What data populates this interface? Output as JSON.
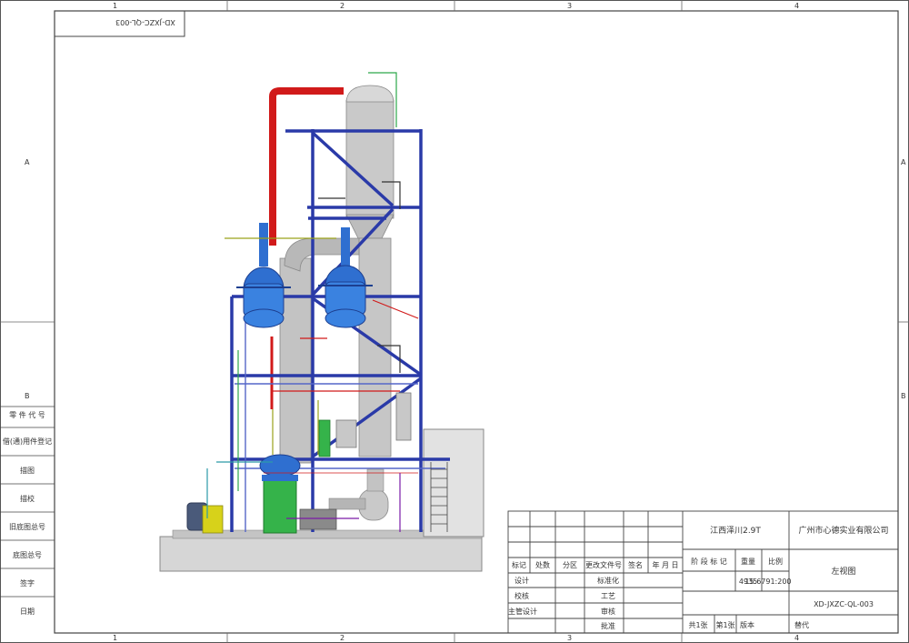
{
  "border": {
    "cols_top": [
      "1",
      "2",
      "3",
      "4"
    ],
    "cols_bottom": [
      "1",
      "2",
      "3",
      "4"
    ],
    "rows_left": [
      "A",
      "B"
    ],
    "rows_right": [
      "A",
      "B"
    ]
  },
  "mirrored_code": "XD-JXZC-QL-003",
  "left_strip": [
    "零 件 代 号",
    "借(通)用件登记",
    "描图",
    "描校",
    "旧底图总号",
    "底图总号",
    "签字",
    "日期"
  ],
  "title_block": {
    "material": "江西泽川2.9T",
    "company": "广州市心德实业有限公司",
    "view_name": "左视图",
    "drawing_no": "XD-JXZC-QL-003",
    "weight_value": "4935",
    "scale_value": "15.6791:200",
    "headers": {
      "mark": "标记",
      "count": "处数",
      "zone": "分区",
      "change_doc": "更改文件号",
      "sign": "签名",
      "date": "年 月 日",
      "stage": "阶 段 标 记",
      "weight": "重量",
      "scale": "比例"
    },
    "rows": {
      "design": "设计",
      "standardize": "标准化",
      "check": "校核",
      "process": "工艺",
      "chief_design": "主管设计",
      "review": "审核",
      "approve": "批准"
    },
    "sheet_total": "共1张",
    "sheet_no": "第1张",
    "version": "版本",
    "replace": "替代"
  },
  "colors": {
    "frame": "#d8d8d8",
    "column": "#6e6e6e",
    "shell": "#c8c8c8",
    "tank_blue": "#2f6fd0",
    "tank_green": "#35b34a",
    "pipe_red": "#d11a1a",
    "motor": "#4a5a7a",
    "base": "#d0d0d0"
  }
}
